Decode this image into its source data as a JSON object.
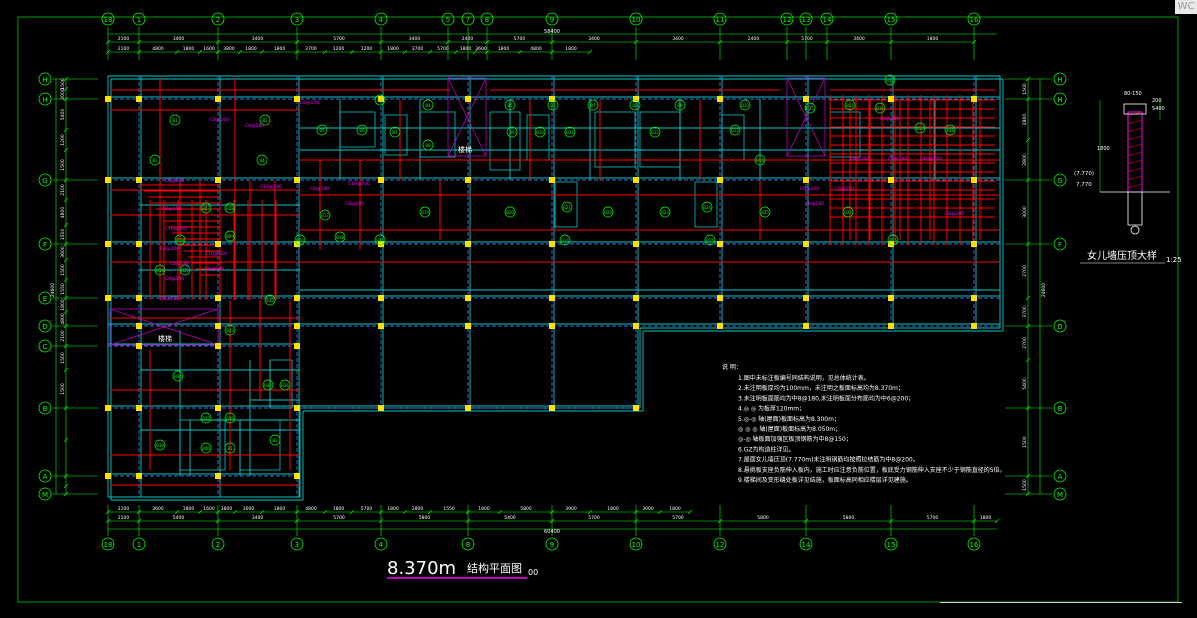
{
  "app": {
    "corner_tab": "WC"
  },
  "drawing": {
    "title": "8.370m",
    "title_suffix": "结构平面图",
    "title_scale": "00",
    "stair_label": "楼梯",
    "stair_label_2": "楼梯",
    "detail_title": "女儿墙压顶大样",
    "detail_scale": "1:25",
    "detail_elev": "(7.770)",
    "detail_elev_2": "7.770",
    "detail_top_dim": "80-150",
    "detail_dim_a": "200",
    "detail_dim_b": "5400",
    "detail_dim_c": "1800"
  },
  "axes": {
    "top": [
      "18",
      "1",
      "2",
      "3",
      "4",
      "5",
      "7",
      "8",
      "9",
      "10",
      "11",
      "12",
      "13",
      "14",
      "15",
      "16"
    ],
    "bottom": [
      "18",
      "1",
      "2",
      "3",
      "4",
      "8",
      "9",
      "10",
      "12",
      "14",
      "15",
      "16"
    ],
    "left": [
      "H",
      "H",
      "G",
      "F",
      "E",
      "D",
      "C",
      "B",
      "A",
      "M"
    ],
    "right": [
      "H",
      "H",
      "G",
      "F",
      "D",
      "B",
      "A",
      "M"
    ]
  },
  "dims": {
    "top_row1": [
      "2100",
      "3400",
      "3400",
      "5700",
      "3400",
      "2400",
      "5700",
      "3400",
      "3400",
      "2400",
      "5700",
      "3400",
      "1800"
    ],
    "top_total": "58400",
    "top_row2": [
      "2100",
      "4800",
      "1800",
      "1600",
      "3800",
      "1800",
      "1800",
      "2700",
      "1200",
      "1200",
      "1800",
      "3700",
      "5700",
      "1800",
      "3600",
      "1800",
      "4800",
      "1800"
    ],
    "bottom_row1": [
      "2100",
      "3600",
      "1800",
      "1600",
      "3800",
      "3000",
      "1800",
      "4800",
      "1800",
      "5700",
      "1800",
      "2800",
      "1550",
      "1800",
      "5800",
      "3900",
      "1800",
      "3000",
      "1800"
    ],
    "bottom_row2": [
      "2100",
      "5400",
      "3400",
      "5700",
      "5800",
      "5400",
      "5700",
      "5700",
      "5800",
      "5800",
      "5700",
      "1800"
    ],
    "bottom_total": "60400",
    "left_col": [
      "1500",
      "2000",
      "5400",
      "1200",
      "1500",
      "2100",
      "4800",
      "1500",
      "3600",
      "1500",
      "1550",
      "1800",
      "4800",
      "2100",
      "1500",
      "1500"
    ],
    "left_total": "24600",
    "right_col": [
      "1500",
      "2800",
      "2800",
      "3000",
      "2700",
      "3700",
      "2700",
      "5400",
      "1500",
      "1500"
    ],
    "right_total": "24600"
  },
  "notes": {
    "heading": "说 明：",
    "items": [
      "1.图中未标注板编号同结构说明，见总体统计表。",
      "2.未注明板厚均为100mm，未注明之板面标高均为8.370m；",
      "3.未注明板面筋均为中8@180,未注明板面分布筋均为中6@200；",
      "4.◎ ◎ 为板厚120mm；",
      "5.◎-◎ 轴(屋面)板面标高为8.300m；",
      "  ◎ ◎ ◎ 轴(屋面)板面标高为8.050m；",
      "  ◎-◎ 轴板面加强区板顶钢筋为中8@150；",
      "6.GZ为构造柱详见。",
      "7.屋面女儿墙压顶(7.770m)未注明钢筋均按照拉结筋为中8@200。",
      "8.悬挑板支座负筋伸入板内，施工时应注意负筋位置，板底受力钢筋伸入支座不少于钢筋直径的5倍。",
      "9.楼梯间及变形缝处板详见结施，板面标高同相应楼层详见建施。"
    ]
  },
  "slab_labels": [
    "B1",
    "B2",
    "B3",
    "B4",
    "B5",
    "B6",
    "B7",
    "B8",
    "B9",
    "B10",
    "B11",
    "B12",
    "B13",
    "B14",
    "B15",
    "B16",
    "B17",
    "B18",
    "B19",
    "B20",
    "B21",
    "B22",
    "B23",
    "B24",
    "B25",
    "B26",
    "B27",
    "B28",
    "B29",
    "B30",
    "B31",
    "B32",
    "B33",
    "B34",
    "B35",
    "B36",
    "B37",
    "B38",
    "B39",
    "B40"
  ],
  "magenta_labels": [
    "C8@200",
    "C8@180",
    "C8@150",
    "C10@200",
    "C8@200",
    "C8@180",
    "C10@180",
    "C8@200",
    "C8@150",
    "C10@200",
    "C8@200",
    "C8@180",
    "C8@150",
    "C8@200",
    "C10@200",
    "C8@180",
    "C8@200",
    "C8@150",
    "C8@200",
    "C8@180",
    "C10@150",
    "C8@200",
    "C8@180",
    "C8@200"
  ],
  "colors": {
    "background": "#000000",
    "axis_green": "#00ff00",
    "beam_cyan": "#00c8c8",
    "grid_blue": "#4a6ad8",
    "rebar_red": "#ff0000",
    "label_magenta": "#ff00ff",
    "column_yellow": "#ffe000",
    "text_white": "#ffffff",
    "stair_magenta": "#c000c0"
  }
}
